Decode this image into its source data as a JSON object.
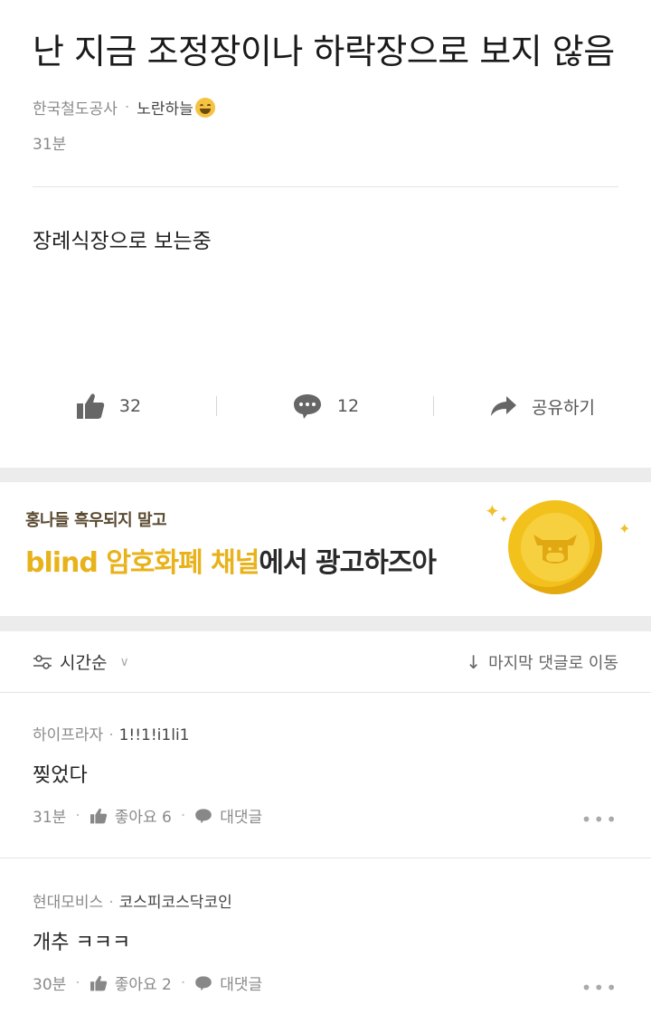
{
  "post": {
    "title": "난 지금 조정장이나 하락장으로 보지 않음",
    "company": "한국철도공사",
    "nickname": "노란하늘",
    "emoji_icon": "grinning-sweat-face",
    "time": "31분",
    "body": "장례식장으로 보는중"
  },
  "actions": {
    "like_count": "32",
    "comment_count": "12",
    "share_label": "공유하기"
  },
  "banner": {
    "subtitle": "홍나들 흑우되지 말고",
    "highlight": "blind 암호화폐 채널",
    "rest": "에서 광고하즈아"
  },
  "sort": {
    "label": "시간순",
    "jump_label": "마지막 댓글로 이동"
  },
  "comments": [
    {
      "company": "하이프라자",
      "nickname": "1!!1!i1li1",
      "body": "찢었다",
      "time": "31분",
      "likes": "좋아요 6",
      "reply": "대댓글"
    },
    {
      "company": "현대모비스",
      "nickname": "코스피코스닥코인",
      "body": "개추 ㅋㅋㅋ",
      "time": "30분",
      "likes": "좋아요 2",
      "reply": "대댓글"
    }
  ],
  "colors": {
    "accent": "#e8b21a",
    "text": "#222222",
    "muted": "#8a8a8a",
    "band": "#ececec"
  }
}
